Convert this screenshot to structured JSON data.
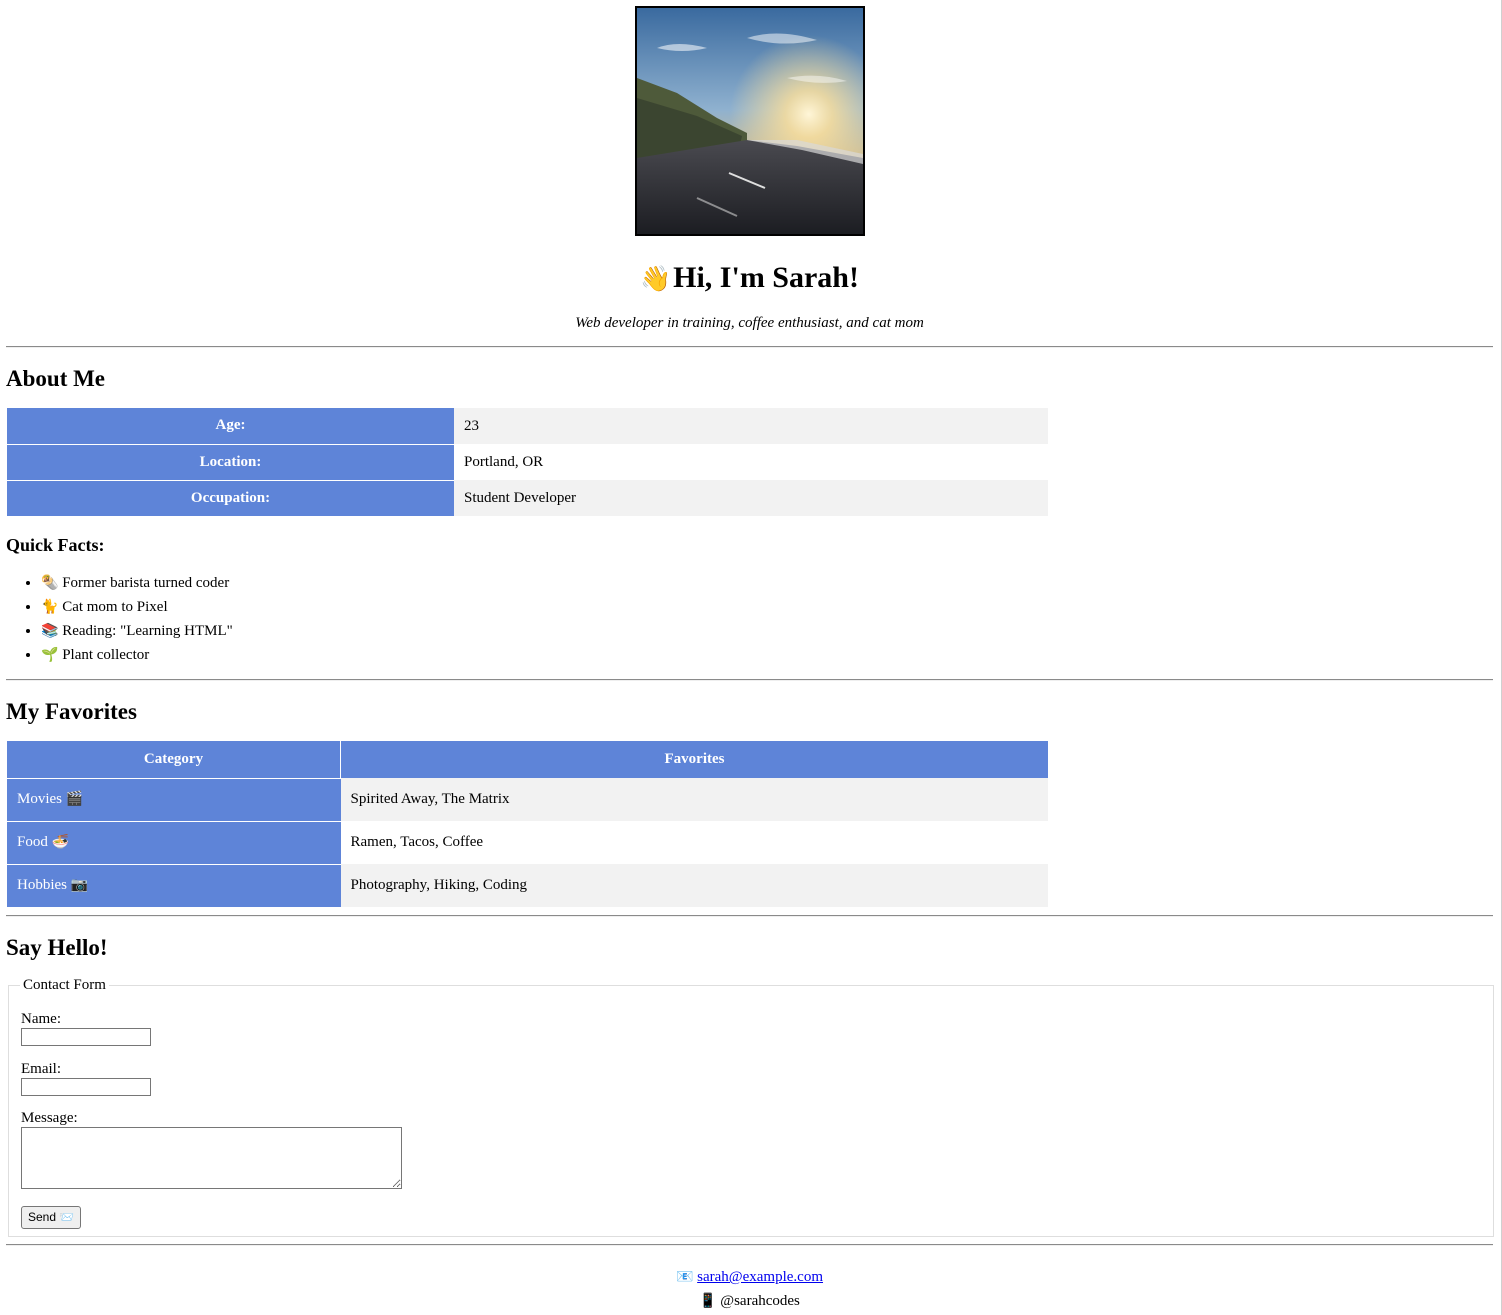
{
  "header": {
    "photo_icon": "landscape-road-sunset-photo",
    "wave_icon": "👋",
    "title": "Hi, I'm Sarah!",
    "tagline": "Web developer in training, coffee enthusiast, and cat mom"
  },
  "about": {
    "heading": "About Me",
    "rows": [
      {
        "label": "Age:",
        "value": "23"
      },
      {
        "label": "Location:",
        "value": "Portland, OR"
      },
      {
        "label": "Occupation:",
        "value": "Student Developer"
      }
    ],
    "quick_facts_heading": "Quick Facts:",
    "facts": [
      {
        "icon": "🌯",
        "text": "Former barista turned coder"
      },
      {
        "icon": "🐈",
        "text": "Cat mom to Pixel"
      },
      {
        "icon": "📚",
        "text": "Reading: \"Learning HTML\""
      },
      {
        "icon": "🌱",
        "text": "Plant collector"
      }
    ]
  },
  "favorites": {
    "heading": "My Favorites",
    "columns": [
      "Category",
      "Favorites"
    ],
    "rows": [
      {
        "category": "Movies",
        "icon": "🎬",
        "value": "Spirited Away, The Matrix"
      },
      {
        "category": "Food",
        "icon": "🍜",
        "value": "Ramen, Tacos, Coffee"
      },
      {
        "category": "Hobbies",
        "icon": "📷",
        "value": "Photography, Hiking, Coding"
      }
    ]
  },
  "contact": {
    "heading": "Say Hello!",
    "legend": "Contact Form",
    "name_label": "Name:",
    "name_value": "",
    "email_label": "Email:",
    "email_value": "",
    "message_label": "Message:",
    "message_value": "",
    "send_label": "Send",
    "send_icon": "📨"
  },
  "footer": {
    "email_icon": "📧",
    "email": "sarah@example.com",
    "phone_icon": "📱",
    "handle": "@sarahcodes"
  },
  "colors": {
    "table_header_bg": "#5e84d8",
    "row_alt_bg": "#f2f2f2",
    "link": "#0000ee"
  }
}
